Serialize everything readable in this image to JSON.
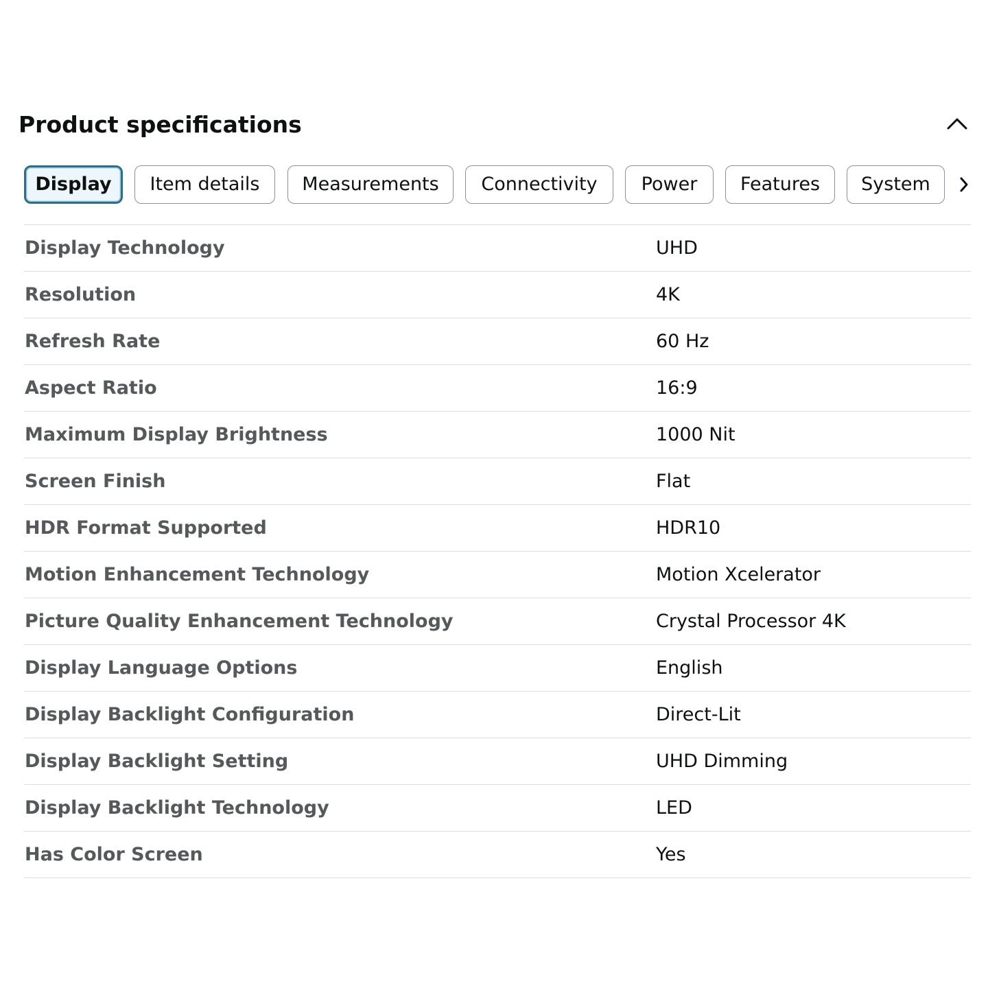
{
  "header": {
    "title": "Product specifications",
    "collapse_icon": "chevron-up-icon"
  },
  "tabs": [
    {
      "label": "Display",
      "active": true
    },
    {
      "label": "Item details",
      "active": false
    },
    {
      "label": "Measurements",
      "active": false
    },
    {
      "label": "Connectivity",
      "active": false
    },
    {
      "label": "Power",
      "active": false
    },
    {
      "label": "Features",
      "active": false
    },
    {
      "label": "System",
      "active": false
    }
  ],
  "tabs_next_icon": "chevron-right-icon",
  "specs": [
    {
      "label": "Display Technology",
      "value": "UHD"
    },
    {
      "label": "Resolution",
      "value": "4K"
    },
    {
      "label": "Refresh Rate",
      "value": "60 Hz"
    },
    {
      "label": "Aspect Ratio",
      "value": "16:9"
    },
    {
      "label": "Maximum Display Brightness",
      "value": "1000 Nit"
    },
    {
      "label": "Screen Finish",
      "value": "Flat"
    },
    {
      "label": "HDR Format Supported",
      "value": "HDR10"
    },
    {
      "label": "Motion Enhancement Technology",
      "value": "Motion Xcelerator"
    },
    {
      "label": "Picture Quality Enhancement Technology",
      "value": "Crystal Processor 4K"
    },
    {
      "label": "Display Language Options",
      "value": "English"
    },
    {
      "label": "Display Backlight Configuration",
      "value": "Direct-Lit"
    },
    {
      "label": "Display Backlight Setting",
      "value": "UHD Dimming"
    },
    {
      "label": "Display Backlight Technology",
      "value": "LED"
    },
    {
      "label": "Has Color Screen",
      "value": "Yes"
    }
  ],
  "colors": {
    "active_tab_border": "#2d6f8b",
    "active_tab_bg": "#edf6fa",
    "label_text": "#565959",
    "value_text": "#0f1111",
    "divider": "#dddddd"
  }
}
